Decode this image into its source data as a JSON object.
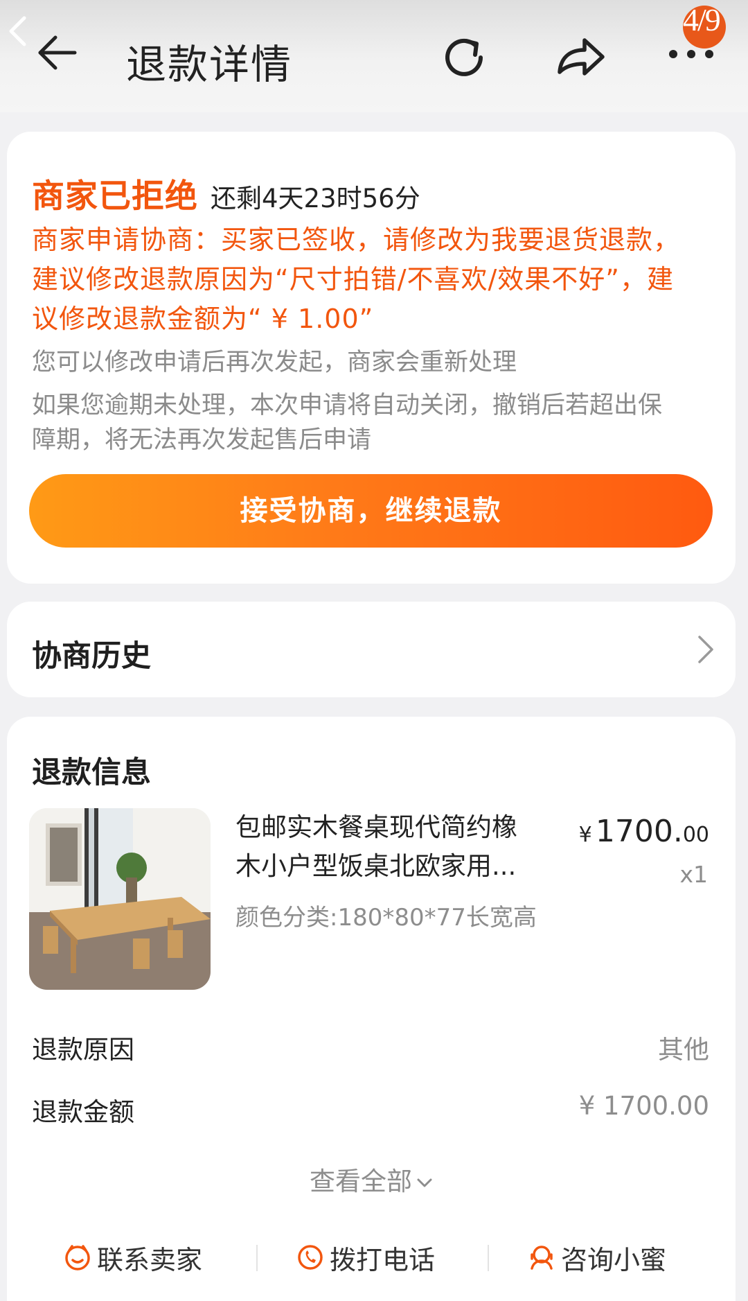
{
  "header": {
    "title": "退款详情",
    "image_counter": "4/9",
    "icons": [
      "viewer-back-icon",
      "back-arrow-icon",
      "refresh-icon",
      "share-icon",
      "more-icon"
    ]
  },
  "status_card": {
    "status": "商家已拒绝",
    "countdown": "还剩4天23时56分",
    "merchant_message_lines": [
      "商家申请协商：买家已签收，请修改为我要退货退款，",
      "建议修改退款原因为“尺寸拍错/不喜欢/效果不好”，建",
      "议修改退款金额为“ ¥ 1.00”"
    ],
    "hint_lines": [
      "您可以修改申请后再次发起，商家会重新处理",
      "如果您逾期未处理，本次申请将自动关闭，撤销后若超出保",
      "障期，将无法再次发起售后申请"
    ],
    "accept_button": "接受协商，继续退款"
  },
  "history": {
    "label": "协商历史"
  },
  "refund_info": {
    "title": "退款信息",
    "product": {
      "name_lines": [
        "包邮实木餐桌现代简约橡",
        "木小户型饭桌北欧家用..."
      ],
      "variant": "颜色分类:180*80*77长宽高",
      "price_currency": "¥",
      "price_integer": "1700.",
      "price_decimal": "00",
      "quantity": "x1"
    },
    "rows": [
      {
        "label": "退款原因",
        "value": "其他"
      },
      {
        "label": "退款金额",
        "value": "¥ 1700.00"
      }
    ],
    "view_all": "查看全部",
    "actions": [
      {
        "label": "联系卖家",
        "icon": "chat-face-icon"
      },
      {
        "label": "拨打电话",
        "icon": "phone-icon"
      },
      {
        "label": "咨询小蜜",
        "icon": "assistant-icon"
      }
    ]
  },
  "colors": {
    "accent_orange": "#f2560e",
    "button_gradient_start": "#ff9a16",
    "button_gradient_end": "#ff5a10",
    "page_background": "#f1f1f3",
    "counter_badge": "#e8581a"
  }
}
